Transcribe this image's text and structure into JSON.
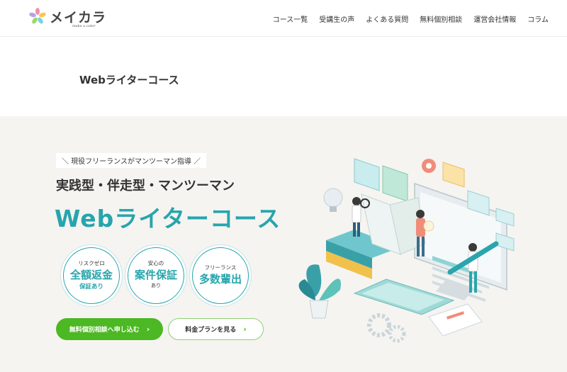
{
  "header": {
    "logo_text": "メイカラ",
    "logo_sub": "make a color",
    "nav": [
      {
        "label": "コース一覧"
      },
      {
        "label": "受講生の声"
      },
      {
        "label": "よくある質問"
      },
      {
        "label": "無料個別相談"
      },
      {
        "label": "運営会社情報"
      },
      {
        "label": "コラム"
      }
    ]
  },
  "page_title": "Webライターコース",
  "hero": {
    "tagline": "＼ 現役フリーランスがマンツーマン指導 ／",
    "subhead": "実践型・伴走型・マンツーマン",
    "title": "Webライターコース",
    "badges": [
      {
        "small": "リスクゼロ",
        "big": "全額返金",
        "tail": "保証あり"
      },
      {
        "small": "安心の",
        "big": "案件保証",
        "tail": "あり"
      },
      {
        "small": "フリーランス",
        "big": "多数輩出",
        "tail": ""
      }
    ],
    "primary_button": "無料個別相談へ申し込む",
    "secondary_button": "料金プランを見る",
    "chevron": "›"
  },
  "colors": {
    "accent": "#27a5ad",
    "primary_button": "#4cb823",
    "secondary_border": "#8fcf73"
  }
}
